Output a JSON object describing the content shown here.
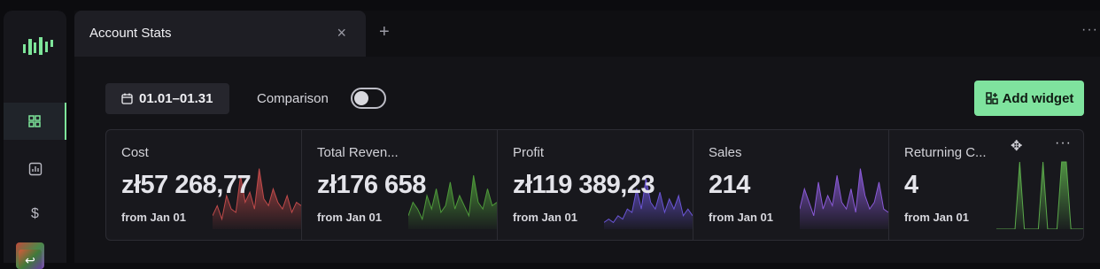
{
  "sidebar": {
    "items": [
      {
        "icon": "dashboard-grid-icon",
        "active": true
      },
      {
        "icon": "bar-chart-icon",
        "active": false
      },
      {
        "icon": "dollar-icon",
        "label": "$",
        "active": false
      },
      {
        "icon": "user-avatar-icon",
        "label": "↩",
        "active": false
      }
    ]
  },
  "tabs": {
    "active_label": "Account Stats",
    "close_label": "×",
    "add_label": "+",
    "more_label": "···"
  },
  "toolbar": {
    "date_range": "01.01–01.31",
    "comparison_label": "Comparison",
    "comparison_on": false,
    "add_widget_label": "Add widget"
  },
  "cards": [
    {
      "title": "Cost",
      "value": "zł57 268,77",
      "sub": "from Jan 01",
      "color": "#c04a4a",
      "series": [
        0.2,
        0.35,
        0.15,
        0.5,
        0.3,
        0.25,
        0.8,
        0.4,
        0.55,
        0.3,
        0.9,
        0.45,
        0.35,
        0.6,
        0.4,
        0.3,
        0.5,
        0.25,
        0.4,
        0.35
      ]
    },
    {
      "title": "Total Reven...",
      "value": "zł176 658",
      "sub": "from Jan 01",
      "color": "#4e9a3a",
      "series": [
        0.2,
        0.4,
        0.3,
        0.15,
        0.5,
        0.3,
        0.6,
        0.25,
        0.35,
        0.7,
        0.3,
        0.5,
        0.35,
        0.2,
        0.8,
        0.4,
        0.3,
        0.6,
        0.35,
        0.4
      ]
    },
    {
      "title": "Profit",
      "value": "zł119 389,23",
      "sub": "from Jan 01",
      "color": "#6a55d6",
      "series": [
        0.1,
        0.15,
        0.1,
        0.2,
        0.15,
        0.3,
        0.25,
        0.6,
        0.3,
        0.75,
        0.4,
        0.3,
        0.55,
        0.25,
        0.45,
        0.3,
        0.5,
        0.2,
        0.3,
        0.2
      ]
    },
    {
      "title": "Sales",
      "value": "214",
      "sub": "from Jan 01",
      "color": "#8a5ad8",
      "series": [
        0.3,
        0.6,
        0.4,
        0.2,
        0.7,
        0.3,
        0.5,
        0.35,
        0.8,
        0.4,
        0.3,
        0.6,
        0.25,
        0.9,
        0.5,
        0.3,
        0.4,
        0.7,
        0.3,
        0.25
      ]
    },
    {
      "title": "Returning C...",
      "value": "4",
      "sub": "from Jan 01",
      "color": "#5aa84a",
      "series": [
        0,
        0,
        0,
        0,
        0,
        1,
        0,
        0,
        0,
        0,
        1,
        0,
        0,
        0,
        1,
        1,
        0,
        0,
        0,
        0
      ]
    }
  ],
  "card_tools": {
    "move_icon": "move-icon",
    "more_label": "···"
  }
}
